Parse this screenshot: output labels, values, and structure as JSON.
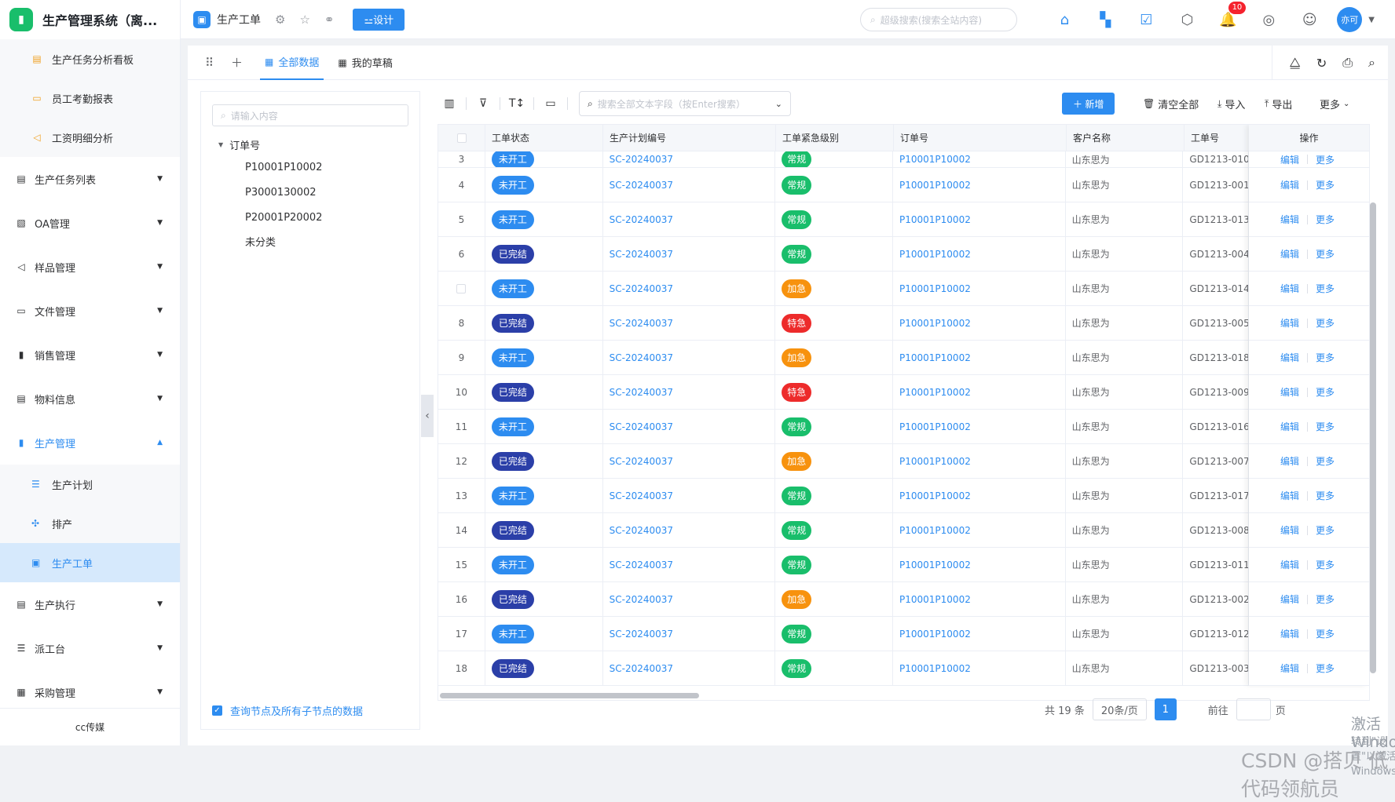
{
  "app": {
    "title": "生产管理系统（离...",
    "footer": "cc传媒"
  },
  "sidebar": {
    "top_subitems": [
      "生产任务分析看板",
      "员工考勤报表",
      "工资明细分析"
    ],
    "items": [
      {
        "label": "生产任务列表",
        "icon": "list-icon"
      },
      {
        "label": "OA管理",
        "icon": "document-icon"
      },
      {
        "label": "样品管理",
        "icon": "megaphone-icon"
      },
      {
        "label": "文件管理",
        "icon": "folder-icon"
      },
      {
        "label": "销售管理",
        "icon": "book-icon"
      },
      {
        "label": "物料信息",
        "icon": "card-icon"
      },
      {
        "label": "生产管理",
        "icon": "book-icon"
      }
    ],
    "sub_items": [
      {
        "label": "生产计划",
        "icon": "list-icon"
      },
      {
        "label": "排产",
        "icon": "puzzle-icon"
      },
      {
        "label": "生产工单",
        "icon": "clipboard-icon"
      }
    ],
    "bottom_items": [
      {
        "label": "生产执行",
        "icon": "card-icon"
      },
      {
        "label": "派工台",
        "icon": "list-icon"
      },
      {
        "label": "采购管理",
        "icon": "grid-icon"
      }
    ]
  },
  "topbar": {
    "page_title": "生产工单",
    "design_label": "⚍设计",
    "search_placeholder": "超级搜索(搜索全站内容)",
    "notification_count": "10",
    "avatar_text": "亦可"
  },
  "tabs": {
    "all_data": "全部数据",
    "my_drafts": "我的草稿"
  },
  "tree": {
    "search_placeholder": "请输入内容",
    "root": "订单号",
    "nodes": [
      "P10001P10002",
      "P3000130002",
      "P20001P20002",
      "未分类"
    ],
    "footer_label": "查询节点及所有子节点的数据"
  },
  "toolbar": {
    "search_placeholder": "搜索全部文本字段（按Enter搜索）",
    "add_label": "新增",
    "clear_label": "清空全部",
    "import_label": "导入",
    "export_label": "导出",
    "more_label": "更多"
  },
  "table": {
    "headers": [
      "工单状态",
      "生产计划编号",
      "工单紧急级别",
      "订单号",
      "客户名称",
      "工单号",
      "操作"
    ],
    "edit_label": "编辑",
    "more_label": "更多",
    "rows": [
      {
        "no": "3",
        "status": "未开工",
        "plan": "SC-20240037",
        "level": "常规",
        "order": "P10001P10002",
        "customer": "山东思为",
        "ticket": "GD1213-010"
      },
      {
        "no": "4",
        "status": "未开工",
        "plan": "SC-20240037",
        "level": "常规",
        "order": "P10001P10002",
        "customer": "山东思为",
        "ticket": "GD1213-001"
      },
      {
        "no": "5",
        "status": "未开工",
        "plan": "SC-20240037",
        "level": "常规",
        "order": "P10001P10002",
        "customer": "山东思为",
        "ticket": "GD1213-013"
      },
      {
        "no": "6",
        "status": "已完结",
        "plan": "SC-20240037",
        "level": "常规",
        "order": "P10001P10002",
        "customer": "山东思为",
        "ticket": "GD1213-004"
      },
      {
        "no": "",
        "status": "未开工",
        "plan": "SC-20240037",
        "level": "加急",
        "order": "P10001P10002",
        "customer": "山东思为",
        "ticket": "GD1213-014"
      },
      {
        "no": "8",
        "status": "已完结",
        "plan": "SC-20240037",
        "level": "特急",
        "order": "P10001P10002",
        "customer": "山东思为",
        "ticket": "GD1213-005"
      },
      {
        "no": "9",
        "status": "未开工",
        "plan": "SC-20240037",
        "level": "加急",
        "order": "P10001P10002",
        "customer": "山东思为",
        "ticket": "GD1213-018"
      },
      {
        "no": "10",
        "status": "已完结",
        "plan": "SC-20240037",
        "level": "特急",
        "order": "P10001P10002",
        "customer": "山东思为",
        "ticket": "GD1213-009"
      },
      {
        "no": "11",
        "status": "未开工",
        "plan": "SC-20240037",
        "level": "常规",
        "order": "P10001P10002",
        "customer": "山东思为",
        "ticket": "GD1213-016"
      },
      {
        "no": "12",
        "status": "已完结",
        "plan": "SC-20240037",
        "level": "加急",
        "order": "P10001P10002",
        "customer": "山东思为",
        "ticket": "GD1213-007"
      },
      {
        "no": "13",
        "status": "未开工",
        "plan": "SC-20240037",
        "level": "常规",
        "order": "P10001P10002",
        "customer": "山东思为",
        "ticket": "GD1213-017"
      },
      {
        "no": "14",
        "status": "已完结",
        "plan": "SC-20240037",
        "level": "常规",
        "order": "P10001P10002",
        "customer": "山东思为",
        "ticket": "GD1213-008"
      },
      {
        "no": "15",
        "status": "未开工",
        "plan": "SC-20240037",
        "level": "常规",
        "order": "P10001P10002",
        "customer": "山东思为",
        "ticket": "GD1213-011"
      },
      {
        "no": "16",
        "status": "已完结",
        "plan": "SC-20240037",
        "level": "加急",
        "order": "P10001P10002",
        "customer": "山东思为",
        "ticket": "GD1213-002"
      },
      {
        "no": "17",
        "status": "未开工",
        "plan": "SC-20240037",
        "level": "常规",
        "order": "P10001P10002",
        "customer": "山东思为",
        "ticket": "GD1213-012"
      },
      {
        "no": "18",
        "status": "已完结",
        "plan": "SC-20240037",
        "level": "常规",
        "order": "P10001P10002",
        "customer": "山东思为",
        "ticket": "GD1213-003"
      }
    ]
  },
  "pagination": {
    "total": "共 19 条",
    "page_size": "20条/页",
    "current_page": "1",
    "goto_label": "前往",
    "page_suffix": "页"
  },
  "overlay": {
    "windows_title": "激活 Windows",
    "windows_sub": "转到\"设置\"以激活 Windows。",
    "csdn": "CSDN @搭贝 低代码领航员"
  },
  "colors": {
    "accent": "#2d8cf0",
    "done": "#2b3fa8",
    "normal": "#19be6b",
    "urgent": "#f7920e",
    "critical": "#ed2b2b"
  }
}
